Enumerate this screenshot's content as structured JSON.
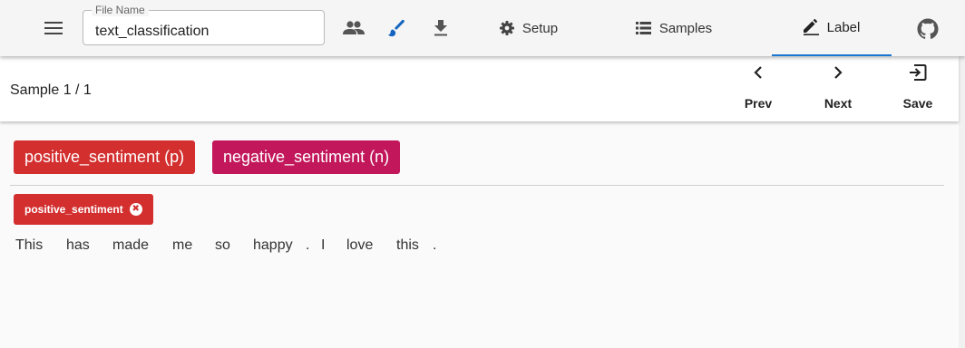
{
  "header": {
    "file_name_label": "File Name",
    "file_name_value": "text_classification",
    "icons": [
      "menu-icon",
      "people-icon",
      "brush-icon",
      "download-icon",
      "github-icon"
    ],
    "tabs": [
      {
        "label": "Setup",
        "icon": "gear-icon"
      },
      {
        "label": "Samples",
        "icon": "list-icon"
      },
      {
        "label": "Label",
        "icon": "pencil-icon",
        "active": true
      }
    ],
    "accent_color": "#1976d2",
    "brush_color": "#1565c0"
  },
  "toolbar": {
    "sample_counter": "Sample 1 / 1",
    "prev_label": "Prev",
    "next_label": "Next",
    "save_label": "Save"
  },
  "labels": {
    "buttons": [
      {
        "text": "positive_sentiment (p)",
        "color": "#d32f2f"
      },
      {
        "text": "negative_sentiment (n)",
        "color": "#c2185b"
      }
    ],
    "selected_chip": {
      "text": "positive_sentiment",
      "remove_glyph": "✖",
      "color": "#d32f2f"
    }
  },
  "sample": {
    "tokens": [
      "This",
      "has",
      "made",
      "me",
      "so",
      "happy",
      ".",
      "I",
      "love",
      "this",
      "."
    ]
  }
}
